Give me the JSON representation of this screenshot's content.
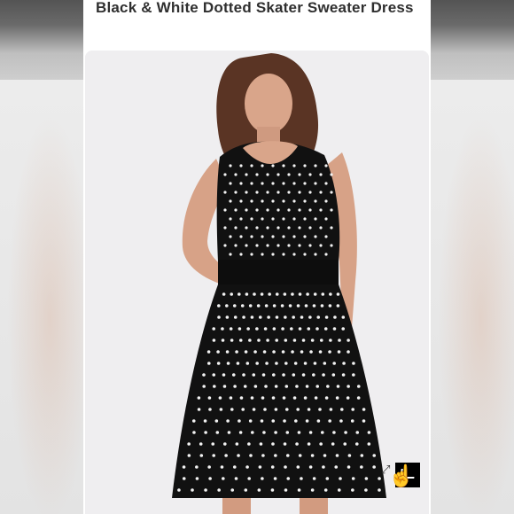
{
  "listing": {
    "title": "Black & White Dotted Skater Sweater Dress"
  },
  "photo": {
    "alt": "Model wearing black and white dotted skater sweater dress",
    "background_color": "#efeef0",
    "dress_color": "#111111",
    "dot_color": "#f3f3f3"
  },
  "icons": {
    "zoom": "zoom-icon",
    "hand": "hand-pointer-icon",
    "expand": "expand-arrows-icon"
  }
}
